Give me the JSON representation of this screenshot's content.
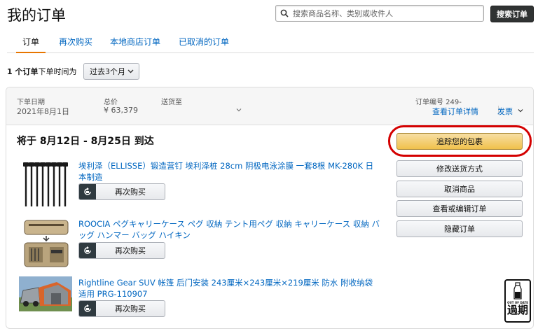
{
  "page": {
    "title": "我的订单"
  },
  "search": {
    "placeholder": "搜索商品名称、类别或收件人",
    "button_label": "搜索订单"
  },
  "tabs": [
    {
      "label": "订单",
      "active": true
    },
    {
      "label": "再次购买",
      "active": false
    },
    {
      "label": "本地商店订单",
      "active": false
    },
    {
      "label": "已取消的订单",
      "active": false
    }
  ],
  "summary": {
    "count_text": "1 个订单",
    "suffix": "下单时间为",
    "range": "过去3个月"
  },
  "order": {
    "date_label": "下单日期",
    "date_value": "2021年8月1日",
    "total_label": "总价",
    "total_value": "¥ 63,379",
    "ship_label": "送货至",
    "order_no_label": "订单编号 249-",
    "details_link": "查看订单详情",
    "invoice_link": "发票",
    "delivery_text": "将于 8月12日 - 8月25日 到达",
    "items": [
      {
        "title": "埃利泽（ELLISSE）锻造营钉 埃利泽桩 28cm 阴极电泳涂膜 一套8根 MK-280K 日本制造",
        "buy_again": "再次购买"
      },
      {
        "title": "ROOCIA ペグキャリーケース ペグ 収納 テント用ペグ 収納 キャリーケース 収納 バッグ ハンマー バッグ ハイキン",
        "buy_again": "再次购买"
      },
      {
        "title": "Rightline Gear SUV 帐篷 后门安装 243厘米×243厘米×219厘米 防水 附收纳袋 适用 PRG-110907",
        "buy_again": "再次购买"
      }
    ],
    "actions": {
      "track": "追踪您的包裹",
      "change_shipping": "修改送货方式",
      "cancel": "取消商品",
      "view_edit": "查看或编辑订单",
      "hide": "隐藏订单"
    }
  },
  "badge": {
    "small": "OUT OF DATE",
    "big": "過期"
  },
  "colors": {
    "link": "#0066c0",
    "accent": "#e77600",
    "track_button": "#f0c14b",
    "highlight": "#d40000"
  }
}
